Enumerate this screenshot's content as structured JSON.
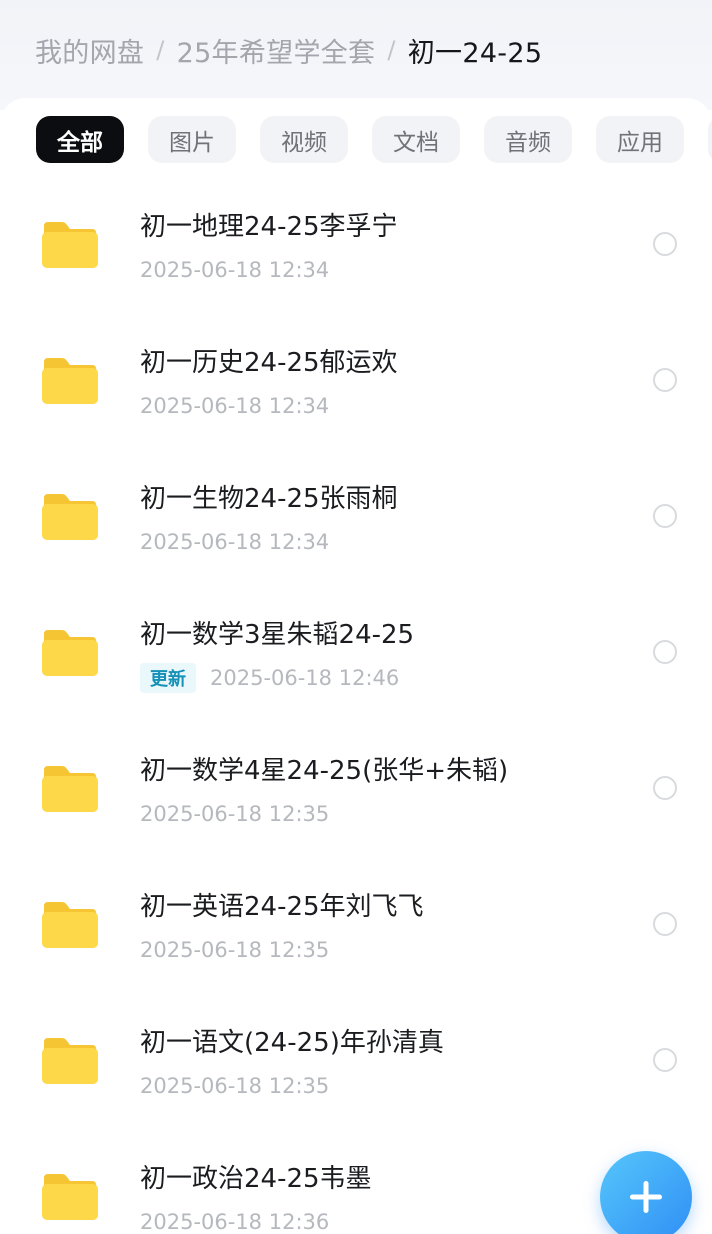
{
  "breadcrumb": [
    {
      "label": "我的网盘"
    },
    {
      "label": "25年希望学全套"
    },
    {
      "label": "初一24-25"
    }
  ],
  "breadcrumb_separator": "/",
  "tabs": [
    {
      "label": "全部",
      "active": true
    },
    {
      "label": "图片",
      "active": false
    },
    {
      "label": "视频",
      "active": false
    },
    {
      "label": "文档",
      "active": false
    },
    {
      "label": "音频",
      "active": false
    },
    {
      "label": "应用",
      "active": false
    }
  ],
  "files": [
    {
      "name": "初一地理24-25李孚宁",
      "date": "2025-06-18  12:34",
      "icon": "folder-icon"
    },
    {
      "name": "初一历史24-25郁运欢",
      "date": "2025-06-18  12:34",
      "icon": "folder-icon"
    },
    {
      "name": "初一生物24-25张雨桐",
      "date": "2025-06-18  12:34",
      "icon": "folder-icon"
    },
    {
      "name": "初一数学3星朱韬24-25",
      "date": "2025-06-18  12:46",
      "badge": "更新",
      "icon": "folder-icon"
    },
    {
      "name": "初一数学4星24-25(张华+朱韬)",
      "date": "2025-06-18  12:35",
      "icon": "folder-icon"
    },
    {
      "name": "初一英语24-25年刘飞飞",
      "date": "2025-06-18  12:35",
      "icon": "folder-icon"
    },
    {
      "name": "初一语文(24-25)年孙清真",
      "date": "2025-06-18  12:35",
      "icon": "folder-icon"
    },
    {
      "name": "初一政治24-25韦墨",
      "date": "2025-06-18  12:36",
      "icon": "folder-icon"
    }
  ],
  "fab_icon": "plus-icon",
  "colors": {
    "active_tab": "#0c0d10",
    "folder": "#fdd94a",
    "badge_text": "#1691b8",
    "fab": "#3aa8f8"
  }
}
